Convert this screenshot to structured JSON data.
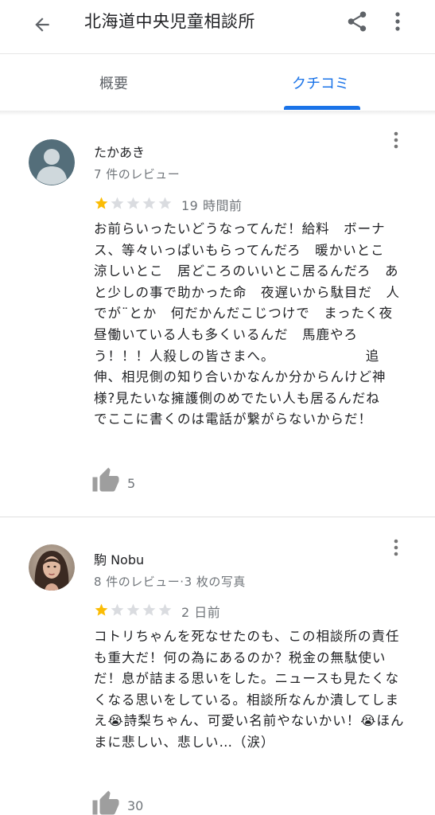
{
  "appbar": {
    "title": "北海道中央児童相談所"
  },
  "tabs": [
    {
      "label": "概要",
      "selected": false
    },
    {
      "label": "クチコミ",
      "selected": true
    }
  ],
  "colors": {
    "accent": "#1a73e8",
    "star_filled": "#fbbc04",
    "star_empty": "#dadce0"
  },
  "reviews": [
    {
      "author": "たかあき",
      "meta": "7 件のレビュー",
      "rating": 1,
      "max_rating": 5,
      "time": "19 時間前",
      "text": "お前らいったいどうなってんだ！給料　ボーナス、等々いっぱいもらってんだろ　暖かいとこ　涼しいとこ　居どころのいいとこ居るんだろ　あと少しの事で助かった命　夜遅いから駄目だ　人でが¨とか　何だかんだこじつけで　まったく夜昼働いている人も多くいるんだ　馬鹿やろう！！！人殺しの皆さまへ。　　　　　　　追伸、相児側の知り合いかなんか分からんけど神様?見たいな擁護側のめでたい人も居るんだね　でここに書くのは電話が繋がらないからだ！",
      "likes": "5",
      "avatar": "default-person-icon"
    },
    {
      "author": "駒 Nobu",
      "meta": "8 件のレビュー·3 枚の写真",
      "rating": 1,
      "max_rating": 5,
      "time": "2 日前",
      "text": "コトリちゃんを死なせたのも、この相談所の責任も重大だ！何の為にあるのか？税金の無駄使いだ！息が詰まる思いをした。ニュースも見たくなくなる思いをしている。相談所なんか潰してしまえ😭詩梨ちゃん、可愛い名前やないかい！😭ほんまに悲しい、悲しい…（涙）",
      "likes": "30",
      "avatar": "profile-photo"
    }
  ]
}
